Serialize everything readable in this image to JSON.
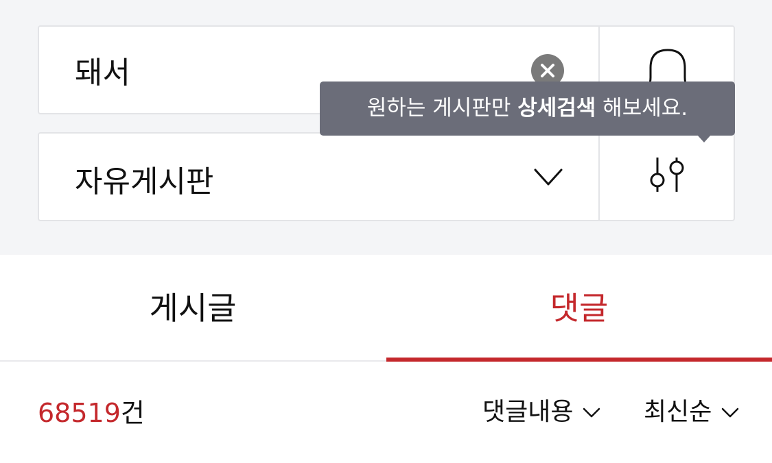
{
  "search": {
    "query": "돼서",
    "clear_label": "검색어 지우기"
  },
  "board": {
    "selected": "자유게시판"
  },
  "tooltip": {
    "prefix": "원하는 게시판만 ",
    "bold": "상세검색",
    "suffix": " 해보세요."
  },
  "tabs": [
    {
      "label": "게시글",
      "active": false
    },
    {
      "label": "댓글",
      "active": true
    }
  ],
  "results": {
    "count": "68519",
    "count_unit": "건",
    "filter_label": "댓글내용",
    "sort_label": "최신순"
  },
  "colors": {
    "accent": "#c4282c",
    "tooltip_bg": "#6b6d79",
    "panel_bg": "#f4f5f7"
  },
  "icons": {
    "clear": "close-circle-icon",
    "alert": "bell-icon",
    "filter": "sliders-icon",
    "dropdown": "chevron-down-icon"
  }
}
